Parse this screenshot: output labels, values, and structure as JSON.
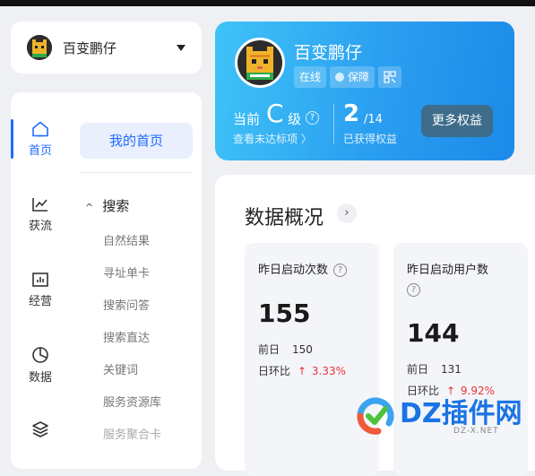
{
  "account": {
    "name": "百变鹏仔"
  },
  "nav": {
    "rail": [
      {
        "label": "首页",
        "icon": "home-icon",
        "active": true
      },
      {
        "label": "获流",
        "icon": "trend-icon"
      },
      {
        "label": "经营",
        "icon": "bar-chart-icon"
      },
      {
        "label": "数据",
        "icon": "pie-icon"
      },
      {
        "label": "",
        "icon": "layers-icon"
      }
    ],
    "my_home": "我的首页",
    "section": "搜索",
    "items": [
      "自然结果",
      "寻址单卡",
      "搜索问答",
      "搜索直达",
      "关键词",
      "服务资源库",
      "服务聚合卡"
    ]
  },
  "profile": {
    "name": "百变鹏仔",
    "tags": [
      "在线",
      "保障"
    ],
    "level_prefix": "当前",
    "level": "C",
    "level_suffix": "级",
    "level_link": "查看未达标项 〉",
    "rights_count": "2",
    "rights_total": "/14",
    "rights_label": "已获得权益",
    "more_button": "更多权益"
  },
  "overview": {
    "title": "数据概况",
    "cards": [
      {
        "title": "昨日启动次数",
        "value": "155",
        "prev_label": "前日",
        "prev_value": "150",
        "ring_label": "日环比",
        "ring_value": "3.33%"
      },
      {
        "title": "昨日启动用户数",
        "value": "144",
        "prev_label": "前日",
        "prev_value": "131",
        "ring_label": "日环比",
        "ring_value": "9.92%"
      }
    ]
  },
  "colors": {
    "accent": "#1f6bff",
    "up": "#e8333a",
    "card_blue": "#2a9ef0"
  },
  "watermark": {
    "text": "DZ插件网",
    "url": "DZ-X.NET"
  }
}
